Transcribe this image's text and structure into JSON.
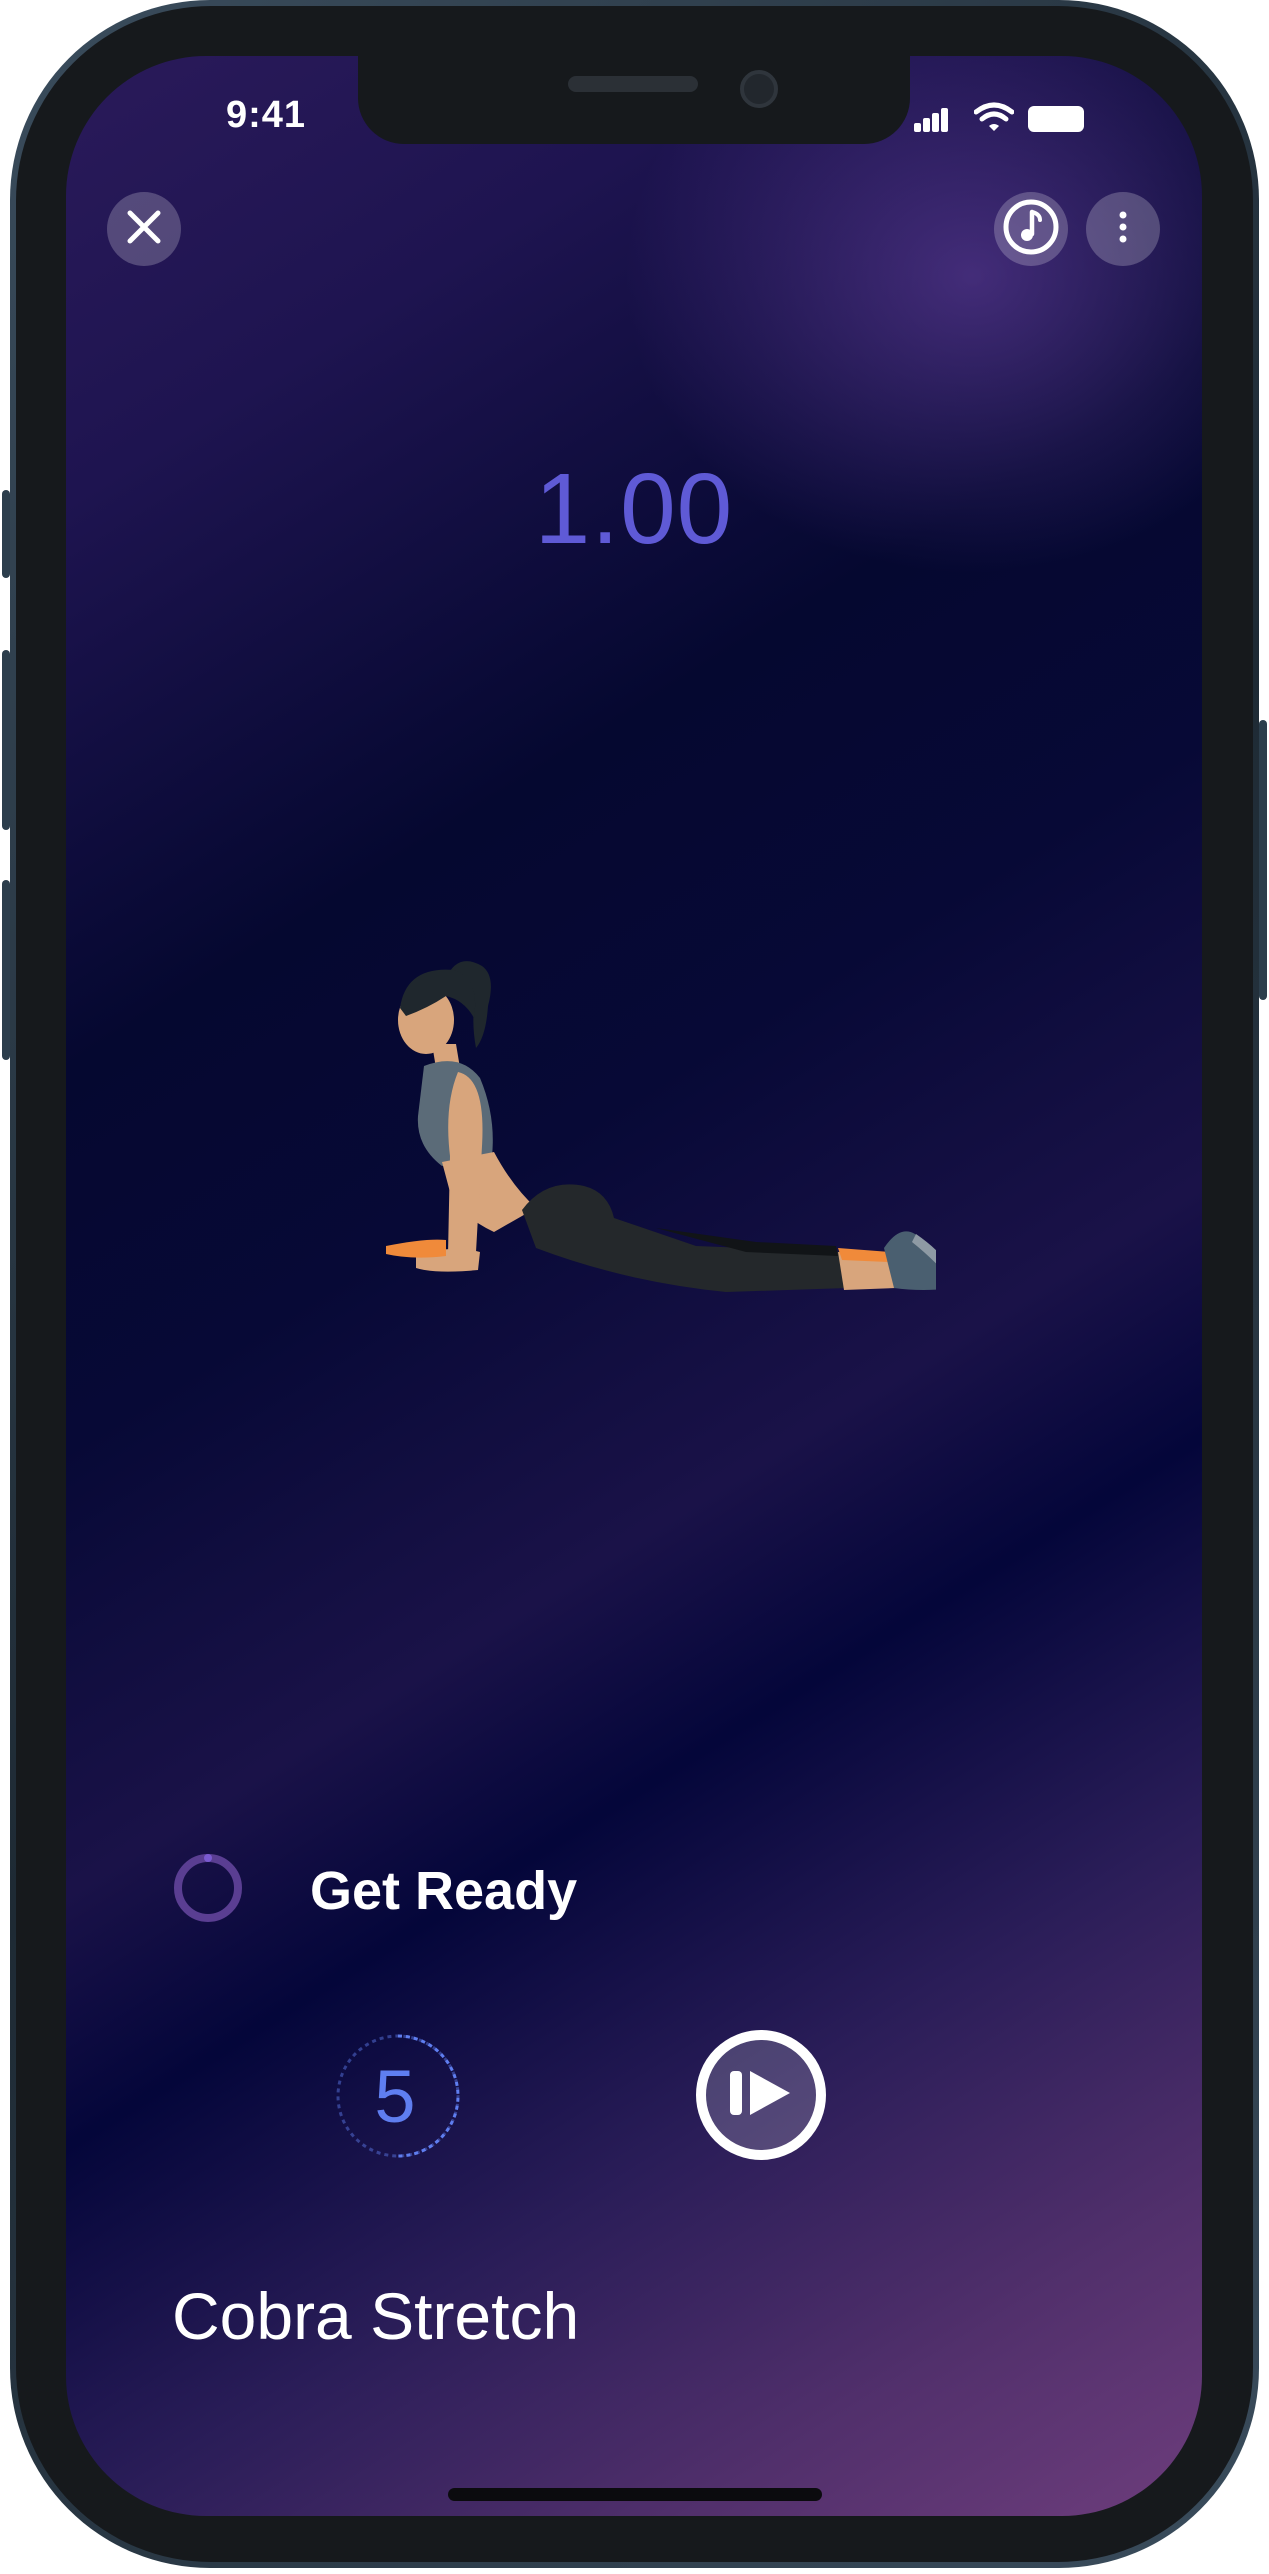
{
  "status_bar": {
    "time": "9:41",
    "signal_icon": "cellular-signal-icon",
    "wifi_icon": "wifi-icon",
    "battery_icon": "battery-icon"
  },
  "toolbar": {
    "close_icon": "close-icon",
    "music_icon": "music-note-icon",
    "more_icon": "more-vertical-icon"
  },
  "timer": {
    "value": "1.00"
  },
  "illustration": {
    "pose": "cobra-stretch-figure"
  },
  "phase": {
    "label": "Get Ready",
    "icon": "progress-ring-icon"
  },
  "countdown": {
    "value": "5",
    "progress": 0.5
  },
  "controls": {
    "play_icon": "play-next-icon"
  },
  "exercise": {
    "name": "Cobra Stretch"
  },
  "colors": {
    "accent": "#5f5ad6",
    "countdown": "#5f7ef0",
    "background_top": "#2a1a5a",
    "background_bottom": "#6d3d7c"
  }
}
